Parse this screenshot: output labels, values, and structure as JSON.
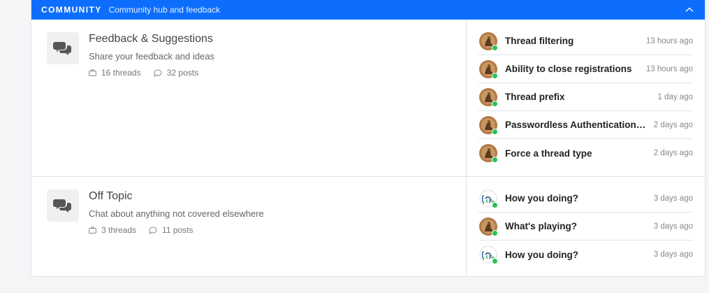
{
  "category": {
    "title": "COMMUNITY",
    "subtitle": "Community hub and feedback",
    "toggle_icon": "chevron-up-icon"
  },
  "colors": {
    "header_bg": "#0d6efd",
    "online_dot": "#23c552"
  },
  "forums": [
    {
      "title": "Feedback & Suggestions",
      "description": "Share your feedback and ideas",
      "threads_label": "16 threads",
      "posts_label": "32 posts",
      "icon": "chat-bubbles-icon",
      "latest": [
        {
          "title": "Thread filtering",
          "time": "13 hours ago",
          "avatar": "bronze-avatar"
        },
        {
          "title": "Ability to close registrations",
          "time": "13 hours ago",
          "avatar": "bronze-avatar"
        },
        {
          "title": "Thread prefix",
          "time": "1 day ago",
          "avatar": "bronze-avatar"
        },
        {
          "title": "Passwordless Authentication Fl...",
          "time": "2 days ago",
          "avatar": "bronze-avatar"
        },
        {
          "title": "Force a thread type",
          "time": "2 days ago",
          "avatar": "bronze-avatar"
        }
      ]
    },
    {
      "title": "Off Topic",
      "description": "Chat about anything not covered elsewhere",
      "threads_label": "3 threads",
      "posts_label": "11 posts",
      "icon": "chat-bubbles-icon",
      "latest": [
        {
          "title": "How you doing?",
          "time": "3 days ago",
          "avatar": "sketch-avatar"
        },
        {
          "title": "What's playing?",
          "time": "3 days ago",
          "avatar": "bronze-avatar"
        },
        {
          "title": "How you doing?",
          "time": "3 days ago",
          "avatar": "sketch-avatar"
        }
      ]
    }
  ]
}
